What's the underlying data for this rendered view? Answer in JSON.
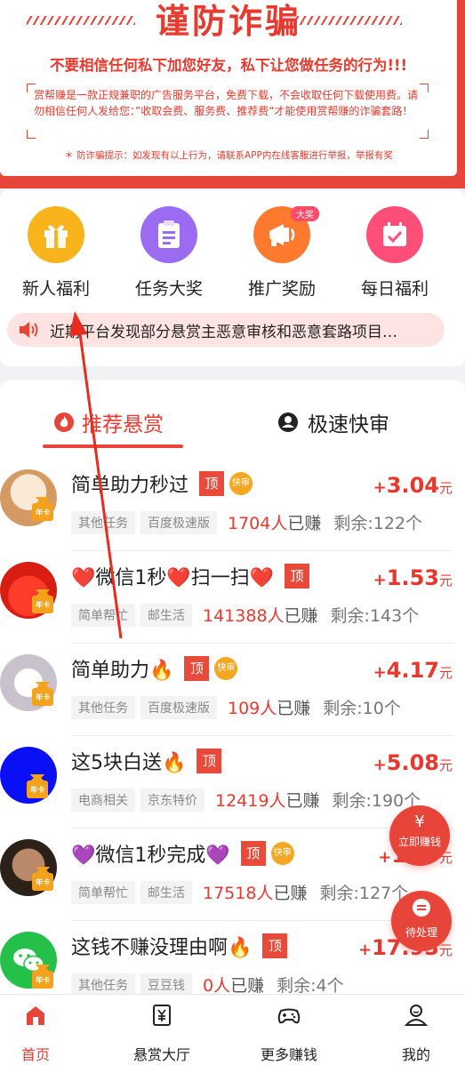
{
  "warning": {
    "title": "谨防诈骗",
    "subtitle": "不要相信任何私下加您好友，私下让您做任务的行为!!!",
    "body": "赏帮赚是一款正规兼职的广告服务平台，免费下载，不会收取任何下载使用费。请勿相信任何人发给您：”收取会费、服务费、推荐费“才能使用赏帮赚的诈骗套路！",
    "tip": "＊ 防诈骗提示：如发现有以上行为，请联系APP内在线客服进行举报，举报有奖"
  },
  "features": [
    {
      "label": "新人福利",
      "icon": "gift-icon",
      "color": "#f8b41a"
    },
    {
      "label": "任务大奖",
      "icon": "clipboard-icon",
      "color": "#9b6cf2"
    },
    {
      "label": "推广奖励",
      "icon": "megaphone-icon",
      "color": "#ff7a2e",
      "badge": "大奖"
    },
    {
      "label": "每日福利",
      "icon": "calendar-check-icon",
      "color": "#ff4f78"
    }
  ],
  "notice": {
    "text": "近期平台发现部分悬赏主恶意审核和恶意套路项目…"
  },
  "tabs": {
    "active": "推荐悬赏",
    "other": "极速快审"
  },
  "tasks": [
    {
      "title": "简单助力秒过",
      "top_badge": "顶",
      "fast_badge": "快审",
      "tags": [
        "其他任务",
        "百度极速版"
      ],
      "earned": "1704人",
      "earned_suffix": "已赚",
      "remain": "剩余:122个",
      "reward": "3.04",
      "unit": "元",
      "avatar": "#f5d7b8"
    },
    {
      "title": "❤️微信1秒❤️扫一扫❤️",
      "top_badge": "顶",
      "tags": [
        "简单帮忙",
        "邮生活"
      ],
      "earned": "141388人",
      "earned_suffix": "已赚",
      "remain": "剩余:143个",
      "reward": "1.53",
      "unit": "元",
      "avatar": "#e8291c"
    },
    {
      "title": "简单助力🔥",
      "top_badge": "顶",
      "fast_badge": "快审",
      "tags": [
        "其他任务",
        "百度极速版"
      ],
      "earned": "109人",
      "earned_suffix": "已赚",
      "remain": "剩余:10个",
      "reward": "4.17",
      "unit": "元",
      "avatar": "#ece8ec"
    },
    {
      "title": "这5块白送🔥",
      "top_badge": "顶",
      "tags": [
        "电商相关",
        "京东特价"
      ],
      "earned": "12419人",
      "earned_suffix": "已赚",
      "remain": "剩余:190个",
      "reward": "5.08",
      "unit": "元",
      "avatar": "#0a10f5"
    },
    {
      "title": "💜微信1秒完成💜",
      "top_badge": "顶",
      "fast_badge": "快审",
      "tags": [
        "简单帮忙",
        "邮生活"
      ],
      "earned": "17518人",
      "earned_suffix": "已赚",
      "remain": "剩余:127个",
      "reward": "1.??",
      "unit": "元",
      "avatar": "#3a2d26"
    },
    {
      "title": "这钱不赚没理由啊🔥",
      "top_badge": "顶",
      "tags": [
        "其他任务",
        "豆豆钱"
      ],
      "earned": "0人",
      "earned_suffix": "已赚",
      "remain": "剩余:4个",
      "reward": "17.93",
      "unit": "元",
      "avatar": "#25c04a"
    }
  ],
  "avatar_badge": "年卡",
  "reward_prefix": "+",
  "floating": {
    "earn_now": "立即赚钱",
    "earn_icon": "¥",
    "pending": "待处理"
  },
  "nav": [
    {
      "label": "首页",
      "icon": "home-icon",
      "active": true
    },
    {
      "label": "悬赏大厅",
      "icon": "yuan-ticket-icon"
    },
    {
      "label": "更多赚钱",
      "icon": "gamepad-icon"
    },
    {
      "label": "我的",
      "icon": "user-icon"
    }
  ],
  "colors": {
    "brand_red": "#e83a2e",
    "reward_red": "#e8382e"
  }
}
